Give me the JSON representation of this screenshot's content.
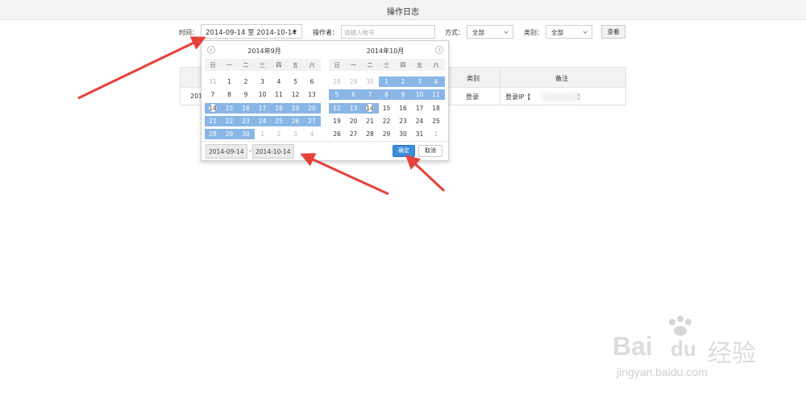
{
  "page": {
    "title": "操作日志"
  },
  "filters": {
    "time_label": "时间：",
    "time_range": "2014-09-14 至 2014-10-14",
    "operator_label": "操作者：",
    "operator_placeholder": "请输入帐号",
    "method_label": "方式：",
    "method_value": "全部",
    "category_label": "类别：",
    "category_value": "全部",
    "search_button": "查看"
  },
  "table": {
    "headers": [
      "类别",
      "备注"
    ],
    "row_time_fragment": "201",
    "row_category": "登录",
    "row_note_prefix": "登录IP【",
    "row_note_suffix": "】"
  },
  "datepicker": {
    "weekdays": [
      "日",
      "一",
      "二",
      "三",
      "四",
      "五",
      "六"
    ],
    "left": {
      "title": "2014年9月",
      "weeks": [
        [
          "31",
          "1",
          "2",
          "3",
          "4",
          "5",
          "6"
        ],
        [
          "7",
          "8",
          "9",
          "10",
          "11",
          "12",
          "13"
        ],
        [
          "14",
          "15",
          "16",
          "17",
          "18",
          "19",
          "20"
        ],
        [
          "21",
          "22",
          "23",
          "24",
          "25",
          "26",
          "27"
        ],
        [
          "28",
          "29",
          "30",
          "1",
          "2",
          "3",
          "4"
        ]
      ]
    },
    "right": {
      "title": "2014年10月",
      "weeks": [
        [
          "28",
          "29",
          "30",
          "1",
          "2",
          "3",
          "4"
        ],
        [
          "5",
          "6",
          "7",
          "8",
          "9",
          "10",
          "11"
        ],
        [
          "12",
          "13",
          "14",
          "15",
          "16",
          "17",
          "18"
        ],
        [
          "19",
          "20",
          "21",
          "22",
          "23",
          "24",
          "25"
        ],
        [
          "26",
          "27",
          "28",
          "29",
          "30",
          "31",
          "1"
        ]
      ]
    },
    "start_input": "2014-09-14",
    "separator": "-",
    "end_input": "2014-10-14",
    "confirm_button": "确定",
    "cancel_button": "取消"
  },
  "watermark": {
    "brand": "Bai",
    "brand_tail": "du",
    "brand_cn": "经验",
    "url": "jingyan.baidu.com"
  },
  "colors": {
    "range_highlight": "#8ab6e6",
    "confirm_blue": "#3c8ddc",
    "arrow_red": "#e8403a"
  }
}
